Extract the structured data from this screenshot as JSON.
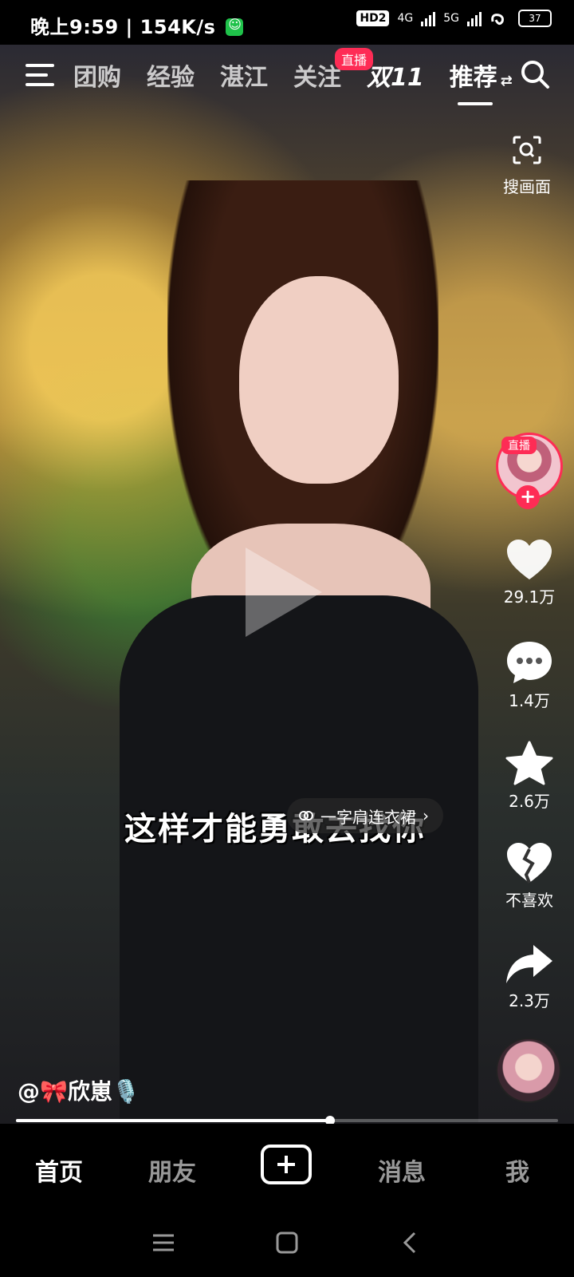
{
  "status_bar": {
    "time_speed": "晚上9:59 | 154K/s",
    "hd": "HD2",
    "net1": "4G",
    "net2": "5G",
    "battery": "37"
  },
  "top_nav": {
    "tabs": [
      "团购",
      "经验",
      "湛江",
      "关注",
      "双11",
      "推荐"
    ],
    "active": "推荐",
    "live_badge": "直播"
  },
  "side": {
    "search_frame_label": "搜画面",
    "avatar_live_tag": "直播",
    "likes": "29.1万",
    "comments": "1.4万",
    "favorites": "2.6万",
    "dislike": "不喜欢",
    "shares": "2.3万"
  },
  "video": {
    "subtitle": "这样才能勇敢去找你",
    "product_tag": "一字肩连衣裙",
    "author": "@🎀欣崽🎙️",
    "progress": 0.58
  },
  "bottom_nav": {
    "home": "首页",
    "friends": "朋友",
    "messages": "消息",
    "me": "我"
  },
  "colors": {
    "accent": "#fe2c55"
  }
}
